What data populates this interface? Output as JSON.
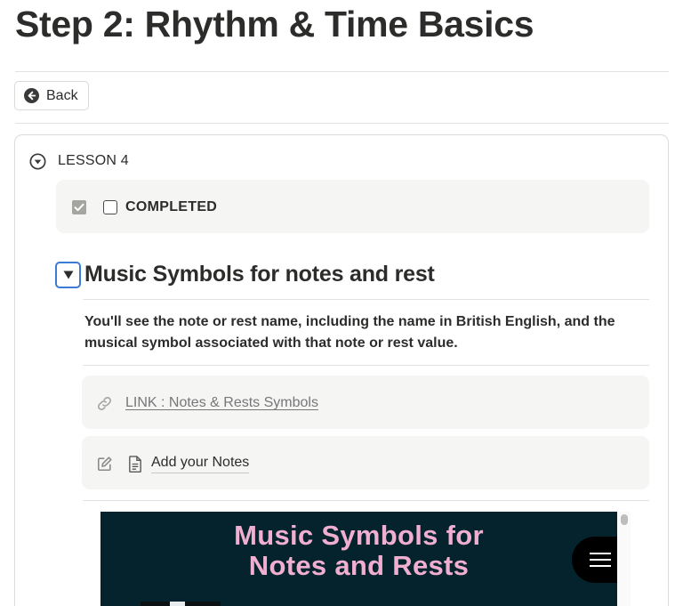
{
  "page": {
    "title": "Step 2: Rhythm & Time Basics"
  },
  "toolbar": {
    "back_label": "Back"
  },
  "lesson": {
    "label": "LESSON 4",
    "completed_label": "COMPLETED",
    "section_title": "Music Symbols for notes and rest",
    "description": "You'll see the note or rest name, including the name in British English, and the musical symbol associated with that note or rest value.",
    "link_label": "LINK : Notes & Rests Symbols",
    "notes_label": "Add your Notes",
    "video": {
      "title_line1": "Music Symbols for",
      "title_line2": "Notes and Rests"
    }
  },
  "icons": {
    "back": "arrow-left-circle-icon",
    "lesson_toggle": "triangle-down-circle-icon",
    "checked": "checked-square-icon",
    "section_toggle": "triangle-down-icon",
    "link": "link-icon",
    "edit": "edit-icon",
    "document": "document-icon",
    "menu": "hamburger-icon"
  },
  "colors": {
    "text": "#2c2c2b",
    "accent_blue": "#3b7bd5",
    "video_bg": "#05232c",
    "video_title": "#f0aed0",
    "muted": "#77777a"
  }
}
